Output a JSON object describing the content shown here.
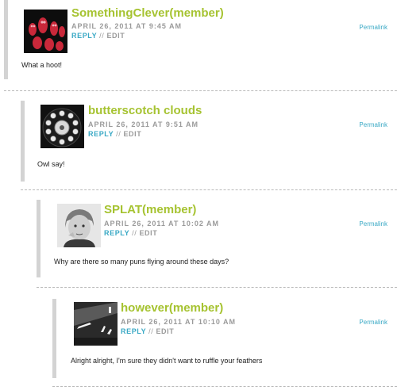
{
  "comments": [
    {
      "author": "SomethingClever(member)",
      "date": "APRIL 26, 2011 AT 9:45 AM",
      "reply": "REPLY",
      "separator": "//",
      "edit": "EDIT",
      "permalink": "Permalink",
      "text": "What a hoot!",
      "avatar_icon": "owls-avatar-icon"
    },
    {
      "author": "butterscotch clouds",
      "date": "APRIL 26, 2011 AT 9:51 AM",
      "reply": "REPLY",
      "separator": "//",
      "edit": "EDIT",
      "permalink": "Permalink",
      "text": "Owl say!",
      "avatar_icon": "rotary-phone-avatar-icon"
    },
    {
      "author": "SPLAT(member)",
      "date": "APRIL 26, 2011 AT 10:02 AM",
      "reply": "REPLY",
      "separator": "//",
      "edit": "EDIT",
      "permalink": "Permalink",
      "text": "Why are there so many puns flying around these days?",
      "avatar_icon": "boy-photo-avatar-icon"
    },
    {
      "author": "however(member)",
      "date": "APRIL 26, 2011 AT 10:10 AM",
      "reply": "REPLY",
      "separator": "//",
      "edit": "EDIT",
      "permalink": "Permalink",
      "text": "Alright alright, I'm sure they didn't want to ruffle your feathers",
      "avatar_icon": "road-marking-avatar-icon"
    }
  ],
  "colors": {
    "author": "#a6c331",
    "link": "#3aa9c5",
    "meta": "#9a9a9a",
    "thread_bar": "#d3d3d3"
  }
}
